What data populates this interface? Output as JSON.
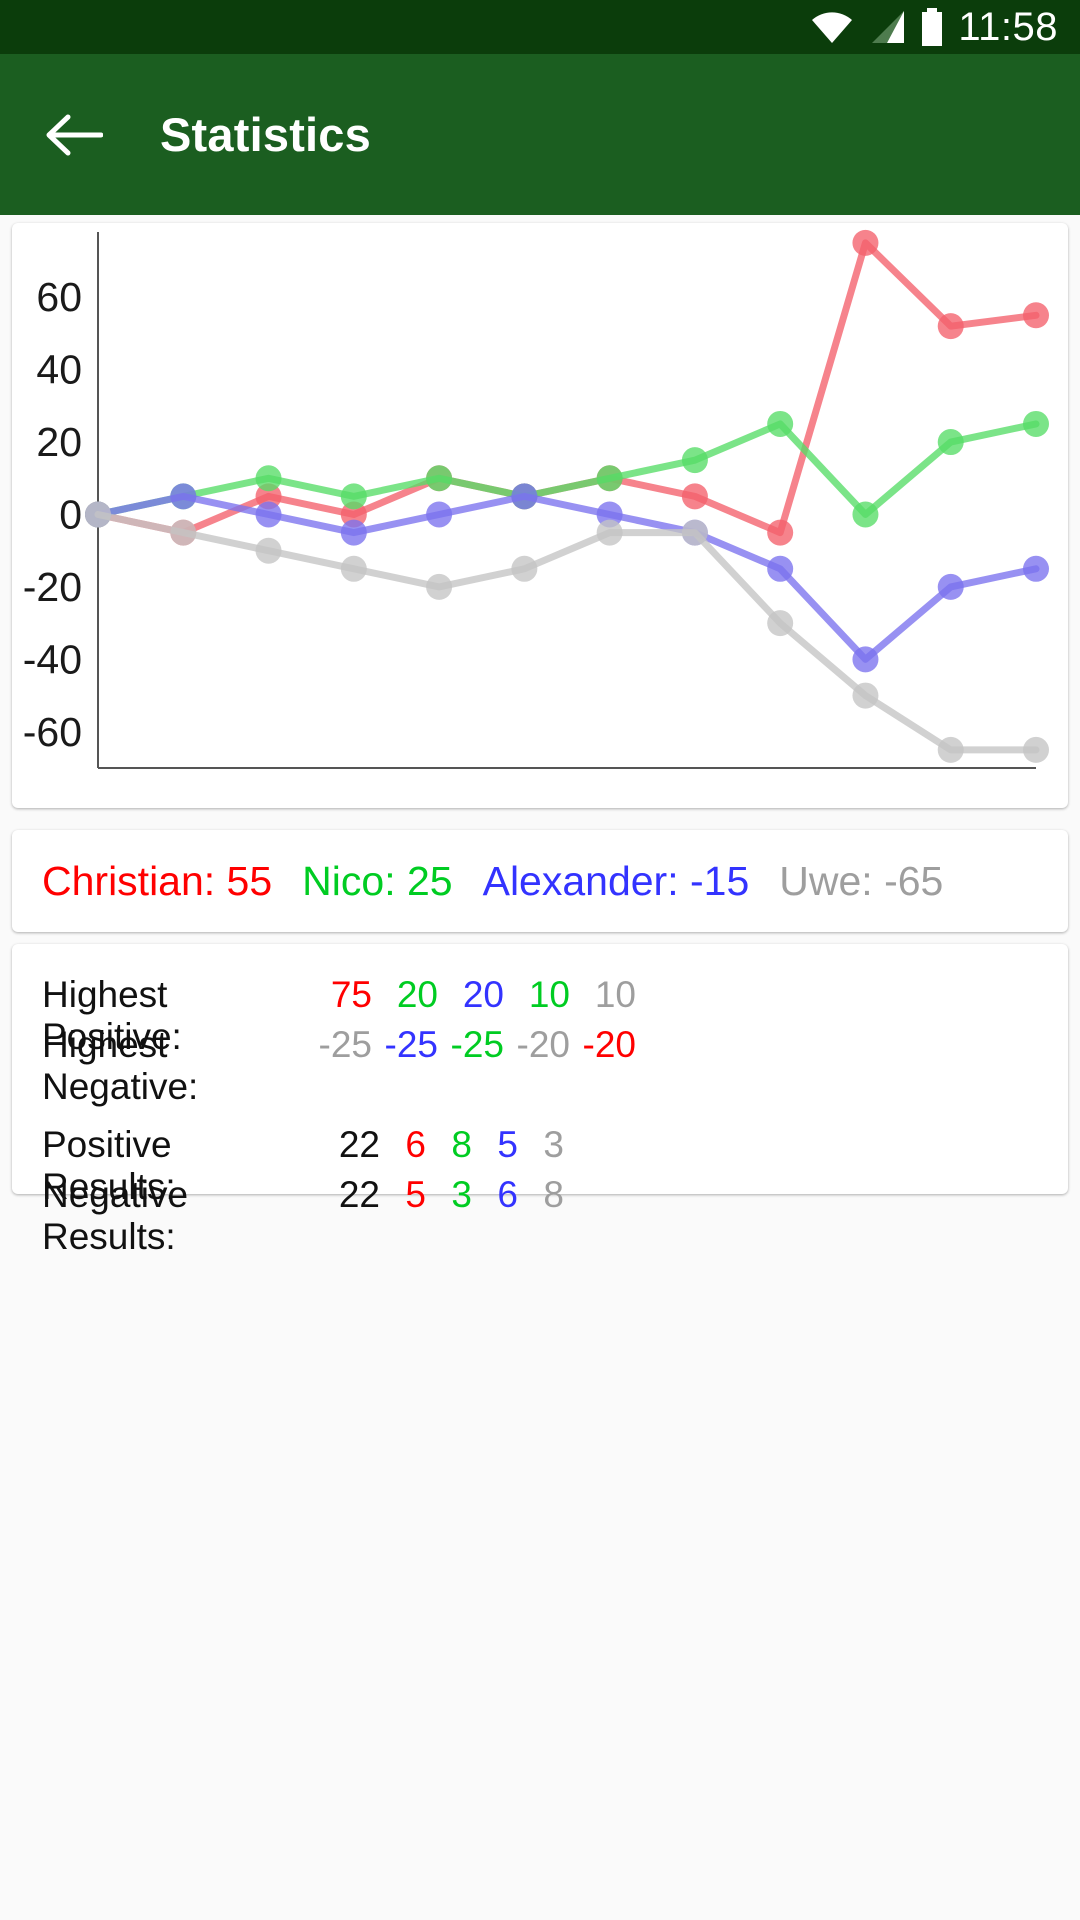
{
  "statusbar": {
    "time": "11:58",
    "icons": [
      "wifi-icon",
      "cell-signal-icon",
      "battery-icon"
    ]
  },
  "appbar": {
    "back_icon": "arrow-left-icon",
    "title": "Statistics"
  },
  "colors": {
    "red": "#FF0000",
    "green": "#00CC22",
    "blue": "#3333FF",
    "grey": "#9E9E9E",
    "series_red": "#F4606C",
    "series_green": "#56DD67",
    "series_blue": "#7B72EE",
    "series_grey": "#C4C4C4",
    "appbar": "#1B5E20",
    "statusbar": "#0B3D0B"
  },
  "legend": {
    "entries": [
      {
        "name": "Christian",
        "value": "55",
        "text": "Christian: 55",
        "color": "#FF0000"
      },
      {
        "name": "Nico",
        "value": "25",
        "text": "Nico: 25",
        "color": "#00CC22"
      },
      {
        "name": "Alexander",
        "value": "-15",
        "text": "Alexander: -15",
        "color": "#3333FF"
      },
      {
        "name": "Uwe",
        "value": "-65",
        "text": "Uwe: -65",
        "color": "#9E9E9E"
      }
    ]
  },
  "stats": {
    "rows": [
      {
        "label": "Highest Positive:",
        "values": [
          {
            "text": "75",
            "color": "#FF0000"
          },
          {
            "text": "20",
            "color": "#00CC22"
          },
          {
            "text": "20",
            "color": "#3333FF"
          },
          {
            "text": "10",
            "color": "#00CC22"
          },
          {
            "text": "10",
            "color": "#9E9E9E"
          }
        ]
      },
      {
        "label": "Highest Negative:",
        "values": [
          {
            "text": "-25",
            "color": "#9E9E9E"
          },
          {
            "text": "-25",
            "color": "#3333FF"
          },
          {
            "text": "-25",
            "color": "#00CC22"
          },
          {
            "text": "-20",
            "color": "#9E9E9E"
          },
          {
            "text": "-20",
            "color": "#FF0000"
          }
        ]
      },
      {
        "label": "Positive Results:",
        "values": [
          {
            "text": "22",
            "color": "#111111"
          },
          {
            "text": "6",
            "color": "#FF0000"
          },
          {
            "text": "8",
            "color": "#00CC22"
          },
          {
            "text": "5",
            "color": "#3333FF"
          },
          {
            "text": "3",
            "color": "#9E9E9E"
          }
        ]
      },
      {
        "label": "Negative Results:",
        "values": [
          {
            "text": "22",
            "color": "#111111"
          },
          {
            "text": "5",
            "color": "#FF0000"
          },
          {
            "text": "3",
            "color": "#00CC22"
          },
          {
            "text": "6",
            "color": "#3333FF"
          },
          {
            "text": "8",
            "color": "#9E9E9E"
          }
        ]
      }
    ]
  },
  "chart_data": {
    "type": "line",
    "title": "",
    "xlabel": "",
    "ylabel": "",
    "x": [
      0,
      1,
      2,
      3,
      4,
      5,
      6,
      7,
      8,
      9,
      10,
      11
    ],
    "ylim": [
      -70,
      78
    ],
    "yticks": [
      60,
      40,
      20,
      0,
      -20,
      -40,
      -60
    ],
    "ytick_labels": [
      "60",
      "40",
      "20",
      "0",
      "-20",
      "-40",
      "-60"
    ],
    "grid": false,
    "legend_position": "below-chart",
    "series": [
      {
        "name": "Christian",
        "color": "#F4606C",
        "values": [
          0,
          -5,
          5,
          0,
          10,
          5,
          10,
          5,
          -5,
          75,
          52,
          55
        ]
      },
      {
        "name": "Nico",
        "color": "#56DD67",
        "values": [
          0,
          5,
          10,
          5,
          10,
          5,
          10,
          15,
          25,
          0,
          20,
          25
        ]
      },
      {
        "name": "Alexander",
        "color": "#7B72EE",
        "values": [
          0,
          5,
          0,
          -5,
          0,
          5,
          0,
          -5,
          -15,
          -40,
          -20,
          -15
        ]
      },
      {
        "name": "Uwe",
        "color": "#C4C4C4",
        "values": [
          0,
          -5,
          -10,
          -15,
          -20,
          -15,
          -5,
          -5,
          -30,
          -50,
          -65,
          -65
        ]
      }
    ]
  }
}
